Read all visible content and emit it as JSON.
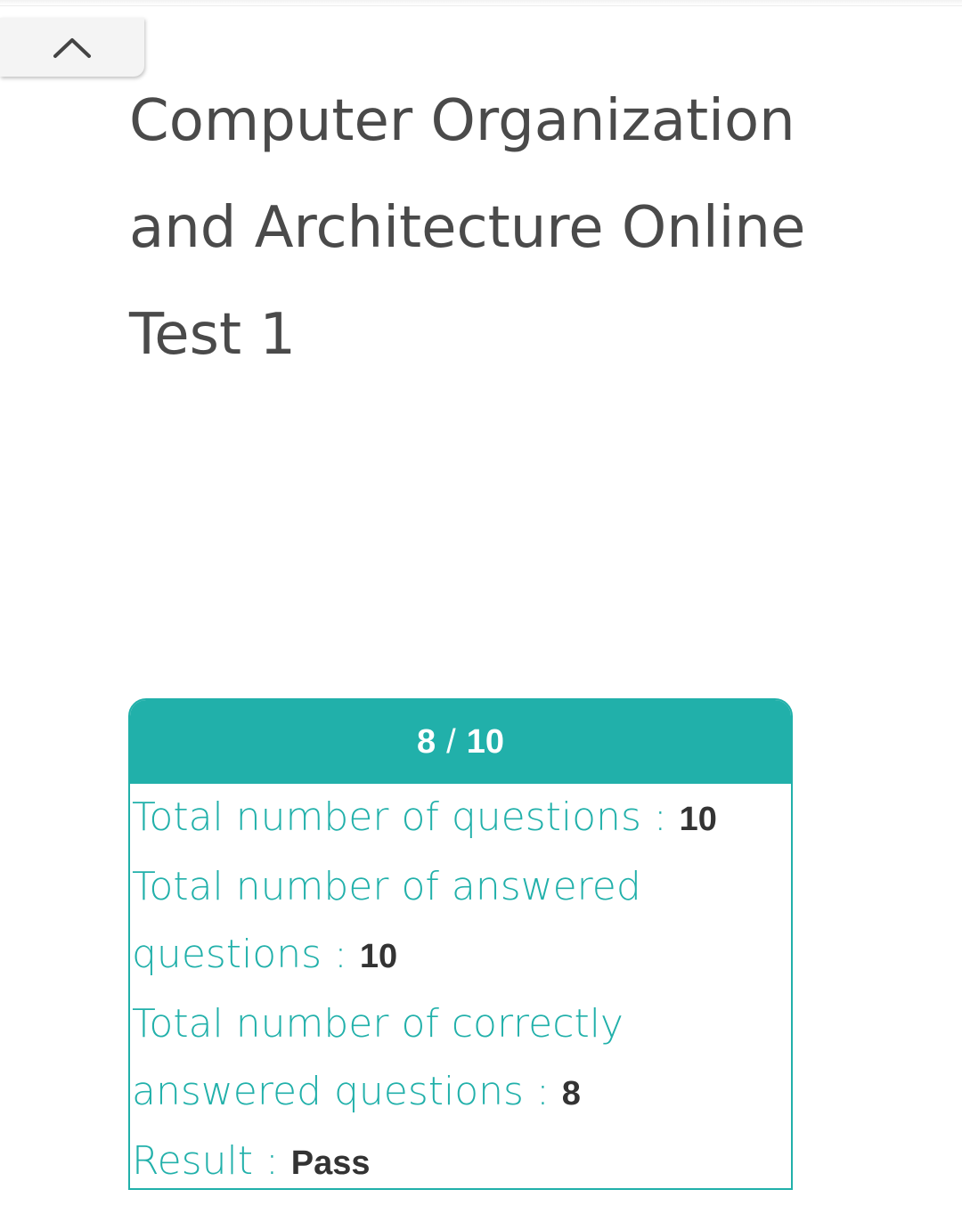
{
  "header": {
    "collapse_icon": "chevron-up-icon"
  },
  "page": {
    "title": "Computer Organization and Architecture Online Test 1"
  },
  "result": {
    "score": "8",
    "separator": "/",
    "max": "10",
    "stats": [
      {
        "label": "Total number of questions : ",
        "value": "10"
      },
      {
        "label": "Total number of answered questions : ",
        "value": "10"
      },
      {
        "label": "Total number of correctly answered questions : ",
        "value": "8"
      },
      {
        "label": "Result : ",
        "value": "Pass"
      }
    ]
  },
  "colors": {
    "accent": "#21b0aa",
    "title_text": "#4a4a4a",
    "value_text": "#333333"
  }
}
